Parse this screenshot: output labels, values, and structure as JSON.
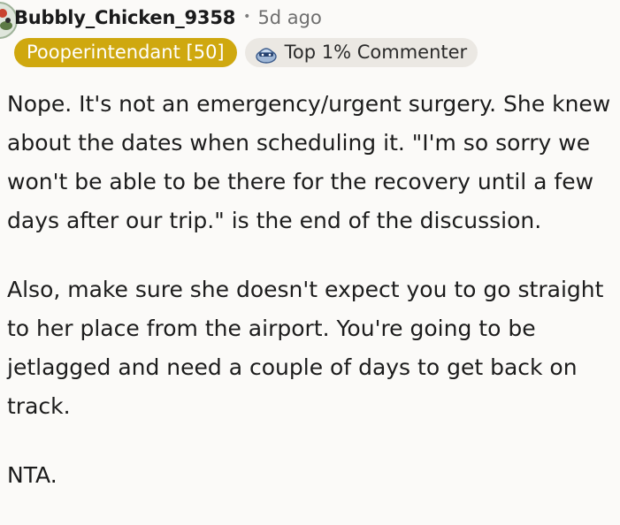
{
  "comment": {
    "author": "Bubbly_Chicken_9358",
    "separator": "•",
    "time_ago": "5d ago",
    "flair": "Pooperintendant [50]",
    "award": {
      "label": "Top 1% Commenter",
      "icon": "top-commenter-icon"
    },
    "paragraphs": [
      "Nope. It's not an emergency/urgent surgery. She knew about the dates when scheduling it. \"I'm so sorry we won't be able to be there for the recovery until a few days after our trip.\" is the end of the discussion.",
      "Also, make sure she doesn't expect you to go straight to her place from the airport. You're going to be jetlagged and need a couple of days to get back on track.",
      "NTA."
    ]
  },
  "colors": {
    "background": "#fbfaf8",
    "flair_background": "#cfa80f",
    "award_background": "#ebe8e3",
    "meta_text": "#6f6f6f"
  }
}
